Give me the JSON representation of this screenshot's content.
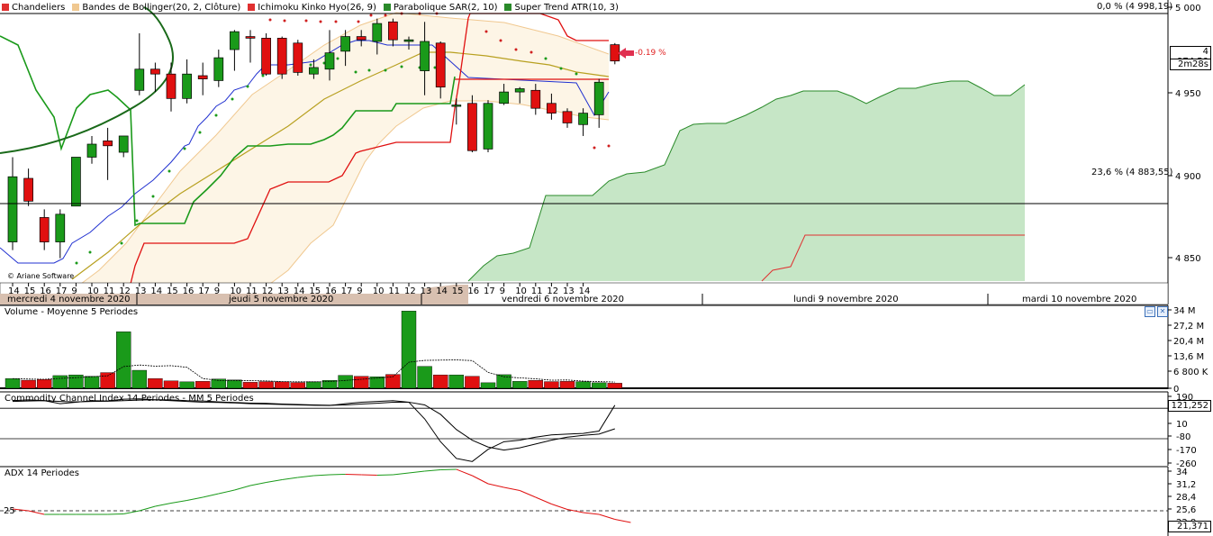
{
  "legend": [
    {
      "label": "Chandeliers",
      "color": "#e03030"
    },
    {
      "label": "Bandes de Bollinger(20, 2, Clôture)",
      "color": "#f0c890"
    },
    {
      "label": "Ichimoku Kinko Hyo(26, 9)",
      "color": "#e03030"
    },
    {
      "label": "Parabolique SAR(2, 10)",
      "color": "#2a8a2a"
    },
    {
      "label": "Super Trend ATR(10, 3)",
      "color": "#2a8a2a"
    }
  ],
  "fibo": {
    "top_label": "0,0 % (4 998,19)",
    "mid_label": "23,6 % (4 883,55)"
  },
  "price_badge": {
    "value": "4 974,50",
    "timer": "2m28s"
  },
  "change_label": "-0.19 %",
  "copyright": "© Ariane Software",
  "panels": {
    "volume_title": "Volume  - Moyenne 5 Periodes",
    "cci_title": "Commodity Channel Index 14 Periodes - MM  5 Periodes",
    "adx_title": "ADX 14 Periodes",
    "cci_badge": "121,252",
    "adx_badge": "21,371",
    "btn_min": "▭",
    "btn_close": "✕"
  },
  "chart_data": {
    "type": "candlestick",
    "price_axis_ticks": [
      "5 000",
      "4 950",
      "4 900",
      "4 850"
    ],
    "volume_axis_ticks": [
      "34 M",
      "27,2 M",
      "20,4 M",
      "13,6 M",
      "6 800 K",
      "0"
    ],
    "cci_axis_ticks": [
      "190",
      "10",
      "-80",
      "-170",
      "-260"
    ],
    "adx_axis_ticks": [
      "34",
      "31,2",
      "28,4",
      "25,6",
      "22,8"
    ],
    "adx_left_label": "25",
    "x_ticks": [
      "14",
      "15",
      "16",
      "17",
      "9",
      "10",
      "11",
      "12",
      "13",
      "14",
      "15",
      "16",
      "17",
      "9",
      "10",
      "11",
      "12",
      "13",
      "14",
      "15",
      "16",
      "17",
      "9",
      "10",
      "11",
      "12",
      "13",
      "14",
      "15",
      "16",
      "17",
      "9",
      "10",
      "11",
      "12",
      "13",
      "14"
    ],
    "date_labels": [
      "mercredi 4 novembre 2020",
      "jeudi 5 novembre 2020",
      "vendredi 6 novembre 2020",
      "lundi 9 novembre 2020",
      "mardi 10 novembre 2020"
    ],
    "candles": [
      {
        "o": 4860,
        "h": 4912,
        "l": 4855,
        "c": 4900
      },
      {
        "o": 4899,
        "h": 4905,
        "l": 4882,
        "c": 4885
      },
      {
        "o": 4875,
        "h": 4880,
        "l": 4855,
        "c": 4860
      },
      {
        "o": 4860,
        "h": 4880,
        "l": 4850,
        "c": 4877
      },
      {
        "o": 4882,
        "h": 4912,
        "l": 4882,
        "c": 4912
      },
      {
        "o": 4912,
        "h": 4925,
        "l": 4908,
        "c": 4920
      },
      {
        "o": 4922,
        "h": 4930,
        "l": 4898,
        "c": 4919
      },
      {
        "o": 4915,
        "h": 4925,
        "l": 4912,
        "c": 4925
      },
      {
        "o": 4953,
        "h": 4988,
        "l": 4950,
        "c": 4966
      },
      {
        "o": 4966,
        "h": 4970,
        "l": 4952,
        "c": 4963
      },
      {
        "o": 4963,
        "h": 4970,
        "l": 4940,
        "c": 4948
      },
      {
        "o": 4948,
        "h": 4972,
        "l": 4945,
        "c": 4963
      },
      {
        "o": 4962,
        "h": 4970,
        "l": 4950,
        "c": 4960
      },
      {
        "o": 4959,
        "h": 4978,
        "l": 4955,
        "c": 4973
      },
      {
        "o": 4978,
        "h": 4990,
        "l": 4965,
        "c": 4989
      },
      {
        "o": 4986,
        "h": 4990,
        "l": 4970,
        "c": 4985
      },
      {
        "o": 4985,
        "h": 4988,
        "l": 4962,
        "c": 4963
      },
      {
        "o": 4985,
        "h": 4986,
        "l": 4960,
        "c": 4963
      },
      {
        "o": 4982,
        "h": 4984,
        "l": 4962,
        "c": 4964
      },
      {
        "o": 4963,
        "h": 4972,
        "l": 4960,
        "c": 4967
      },
      {
        "o": 4966,
        "h": 4990,
        "l": 4959,
        "c": 4976
      },
      {
        "o": 4977,
        "h": 4990,
        "l": 4968,
        "c": 4986
      },
      {
        "o": 4986,
        "h": 4990,
        "l": 4980,
        "c": 4984
      },
      {
        "o": 4983,
        "h": 4997,
        "l": 4975,
        "c": 4994
      },
      {
        "o": 4995,
        "h": 4997,
        "l": 4980,
        "c": 4984
      },
      {
        "o": 4983,
        "h": 4986,
        "l": 4978,
        "c": 4984
      },
      {
        "o": 4965,
        "h": 4995,
        "l": 4950,
        "c": 4983
      },
      {
        "o": 4982,
        "h": 4983,
        "l": 4948,
        "c": 4955
      },
      {
        "o": 4944,
        "h": 4948,
        "l": 4932,
        "c": 4944
      },
      {
        "o": 4945,
        "h": 4950,
        "l": 4915,
        "c": 4916
      },
      {
        "o": 4917,
        "h": 4947,
        "l": 4915,
        "c": 4945
      },
      {
        "o": 4945,
        "h": 4957,
        "l": 4944,
        "c": 4952
      },
      {
        "o": 4952,
        "h": 4955,
        "l": 4945,
        "c": 4954
      },
      {
        "o": 4953,
        "h": 4957,
        "l": 4938,
        "c": 4942
      },
      {
        "o": 4945,
        "h": 4951,
        "l": 4935,
        "c": 4939
      },
      {
        "o": 4940,
        "h": 4942,
        "l": 4930,
        "c": 4933
      },
      {
        "o": 4932,
        "h": 4942,
        "l": 4925,
        "c": 4939
      },
      {
        "o": 4938,
        "h": 4960,
        "l": 4930,
        "c": 4958
      },
      {
        "o": 4981,
        "h": 4982,
        "l": 4969,
        "c": 4971
      }
    ],
    "volume": [
      4.2,
      3.5,
      3.8,
      5.5,
      5.8,
      5.2,
      6.8,
      24.5,
      7.8,
      4.2,
      3.2,
      2.8,
      3.0,
      4.0,
      3.6,
      2.6,
      2.9,
      2.8,
      2.5,
      2.8,
      3.4,
      5.6,
      5.2,
      5.0,
      6.0,
      33.5,
      9.5,
      5.8,
      5.8,
      5.2,
      2.4,
      5.9,
      3.0,
      3.4,
      2.9,
      3.0,
      2.9,
      2.4,
      2.2
    ],
    "volume_ma": [
      4.2,
      4.0,
      3.9,
      4.3,
      4.6,
      5.0,
      5.4,
      9.4,
      10.1,
      9.6,
      9.8,
      9.1,
      4.2,
      3.4,
      3.3,
      3.3,
      3.2,
      2.9,
      2.8,
      2.8,
      2.9,
      3.4,
      3.9,
      4.4,
      5.0,
      11.3,
      12.1,
      12.2,
      12.3,
      12.0,
      6.9,
      5.0,
      4.5,
      4.1,
      3.5,
      3.6,
      3.1,
      2.9,
      2.7
    ],
    "cci": [
      150,
      155,
      150,
      130,
      140,
      150,
      148,
      160,
      162,
      155,
      150,
      145,
      140,
      138,
      135,
      130,
      128,
      125,
      122,
      120,
      118,
      130,
      140,
      145,
      150,
      140,
      30,
      -120,
      -230,
      -250,
      -170,
      -120,
      -110,
      -90,
      -75,
      -70,
      -65,
      -50,
      120
    ],
    "cci_ma": [
      145,
      148,
      150,
      145,
      142,
      145,
      146,
      150,
      154,
      156,
      155,
      150,
      148,
      142,
      138,
      134,
      132,
      128,
      125,
      122,
      120,
      122,
      128,
      133,
      140,
      140,
      122,
      60,
      -40,
      -110,
      -155,
      -175,
      -160,
      -135,
      -110,
      -90,
      -78,
      -70,
      -35
    ],
    "adx": [
      25.4,
      25.0,
      24.2,
      24.2,
      24.2,
      24.2,
      24.2,
      24.3,
      25.0,
      26.0,
      26.7,
      27.3,
      28.0,
      28.8,
      29.6,
      30.6,
      31.3,
      31.9,
      32.4,
      32.8,
      33.0,
      33.1,
      33.0,
      32.9,
      33.0,
      33.4,
      33.8,
      34.1,
      34.2,
      32.8,
      31.0,
      30.2,
      29.5,
      28.0,
      26.5,
      25.3,
      24.6,
      24.2,
      23.1,
      22.4
    ]
  }
}
